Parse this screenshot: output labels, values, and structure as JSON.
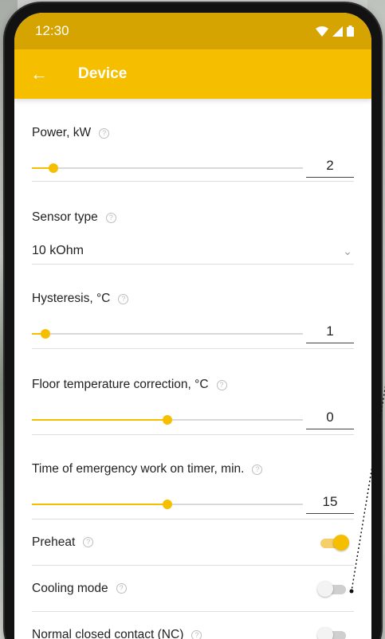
{
  "status_bar": {
    "time": "12:30"
  },
  "app_bar": {
    "title": "Device",
    "back_icon": "arrow-left-icon"
  },
  "colors": {
    "accent": "#f5bf00",
    "status_bar": "#d6a400"
  },
  "settings": {
    "power": {
      "label": "Power, kW",
      "value": "2",
      "slider_fraction": 0.08
    },
    "sensor_type": {
      "label": "Sensor type",
      "value": "10 kOhm"
    },
    "hysteresis": {
      "label": "Hysteresis, °C",
      "value": "1",
      "slider_fraction": 0.05
    },
    "floor_correction": {
      "label": "Floor temperature correction, °C",
      "value": "0",
      "slider_fraction": 0.5
    },
    "emergency_timer": {
      "label": "Time of emergency work on timer, min.",
      "value": "15",
      "slider_fraction": 0.5
    },
    "preheat": {
      "label": "Preheat",
      "on": true
    },
    "cooling_mode": {
      "label": "Cooling mode",
      "on": false
    },
    "nc_contact": {
      "label": "Normal closed contact (NC)",
      "on": false
    }
  }
}
